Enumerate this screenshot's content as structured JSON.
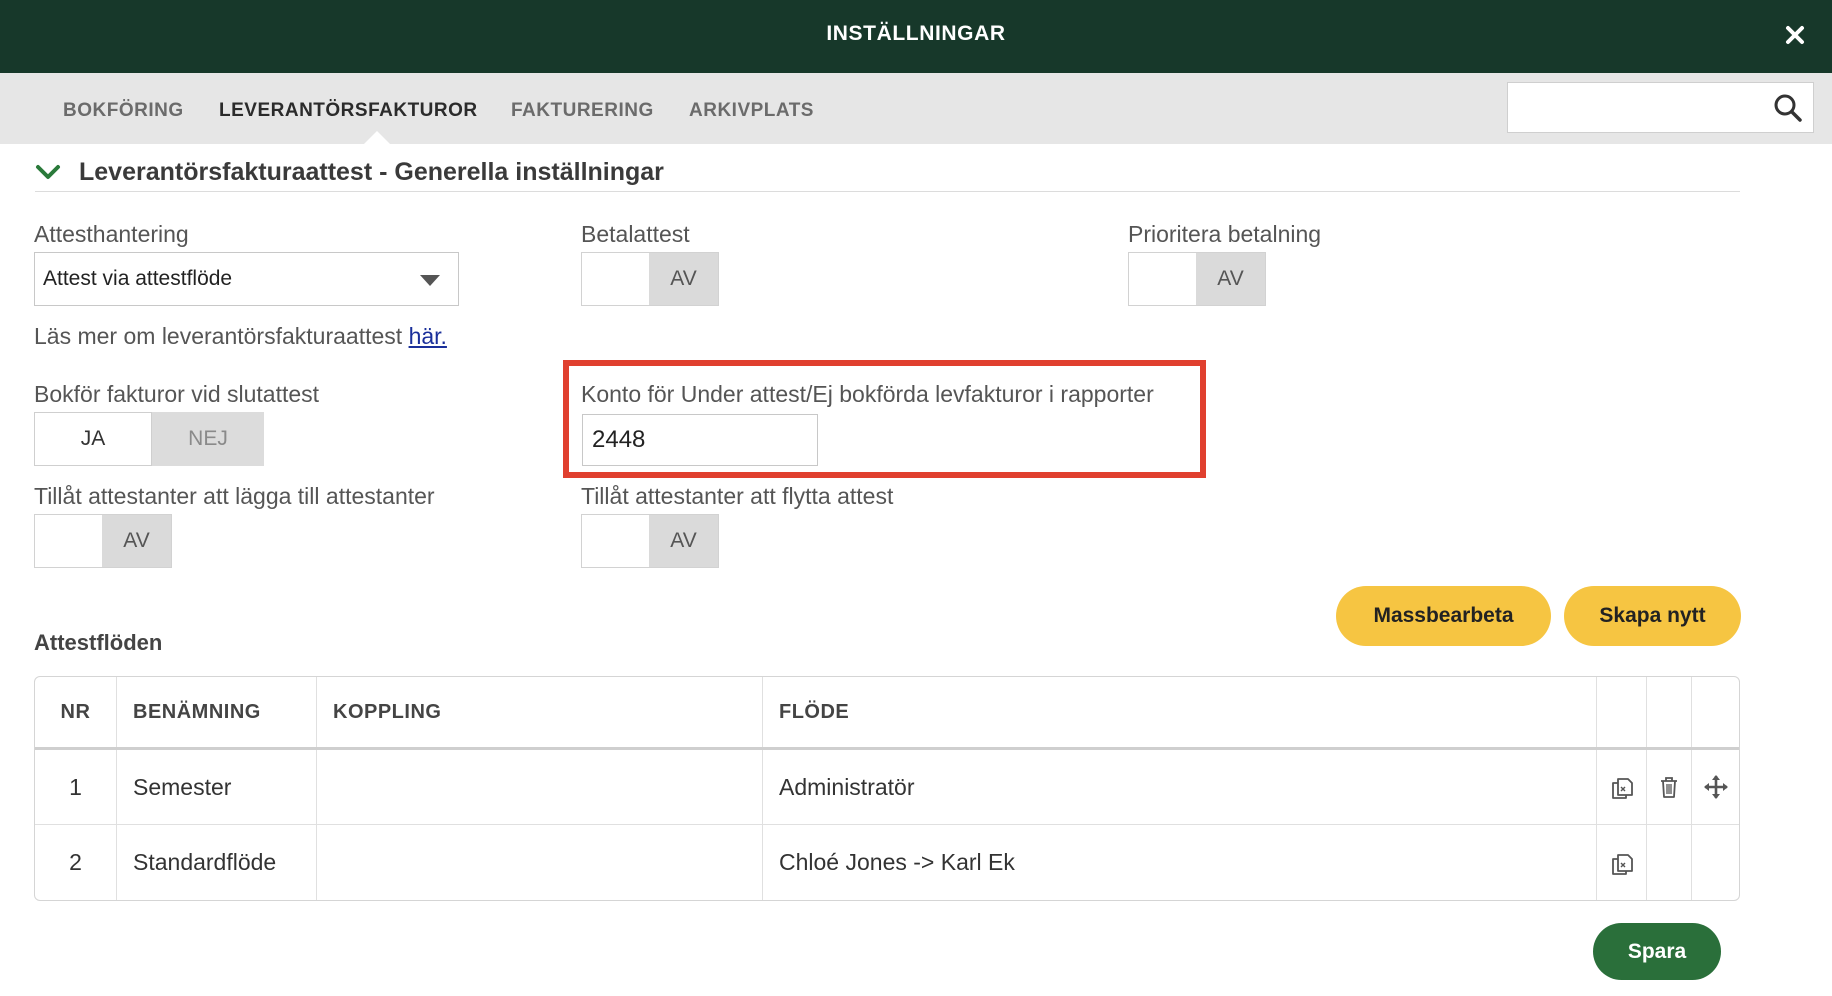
{
  "window": {
    "title": "INSTÄLLNINGAR",
    "close_icon": "close-icon"
  },
  "tabs": [
    {
      "label": "BOKFÖRING",
      "active": false
    },
    {
      "label": "LEVERANTÖRSFAKTUROR",
      "active": true
    },
    {
      "label": "FAKTURERING",
      "active": false
    },
    {
      "label": "ARKIVPLATS",
      "active": false
    }
  ],
  "search": {
    "value": "",
    "placeholder": "",
    "icon": "search-icon"
  },
  "section": {
    "title": "Leverantörsfakturaattest - Generella inställningar",
    "icon": "chevron-down-icon"
  },
  "settings": {
    "attesthantering": {
      "label": "Attesthantering",
      "value": "Attest via attestflöde"
    },
    "betalattest": {
      "label": "Betalattest",
      "state": "AV"
    },
    "prioritera": {
      "label": "Prioritera betalning",
      "state": "AV"
    },
    "readmore": {
      "text": "Läs mer om leverantörsfakturaattest ",
      "link": "här."
    },
    "bokfor": {
      "label": "Bokför fakturor vid slutattest",
      "yes": "JA",
      "no": "NEJ",
      "selected": "JA"
    },
    "konto": {
      "label": "Konto för Under attest/Ej bokförda levfakturor i rapporter",
      "value": "2448"
    },
    "tillat_lagga": {
      "label": "Tillåt attestanter att lägga till attestanter",
      "state": "AV"
    },
    "tillat_flytta": {
      "label": "Tillåt attestanter att flytta attest",
      "state": "AV"
    }
  },
  "attestfloden": {
    "title": "Attestflöden",
    "buttons": {
      "massbearbeta": "Massbearbeta",
      "skapa": "Skapa nytt"
    },
    "columns": [
      "NR",
      "BENÄMNING",
      "KOPPLING",
      "FLÖDE"
    ],
    "rows": [
      {
        "nr": "1",
        "benamning": "Semester",
        "koppling": "",
        "flode": "Administratör",
        "actions": [
          "copy-icon",
          "trash-icon",
          "move-icon"
        ]
      },
      {
        "nr": "2",
        "benamning": "Standardflöde",
        "koppling": "",
        "flode": "Chloé Jones -> Karl Ek",
        "actions": [
          "copy-icon"
        ]
      }
    ]
  },
  "footer": {
    "save": "Spara"
  },
  "colors": {
    "header": "#17382a",
    "accent_yellow": "#f6c542",
    "save_green": "#2a6f3a",
    "highlight": "#e0402f",
    "link": "#1a2f9a"
  }
}
